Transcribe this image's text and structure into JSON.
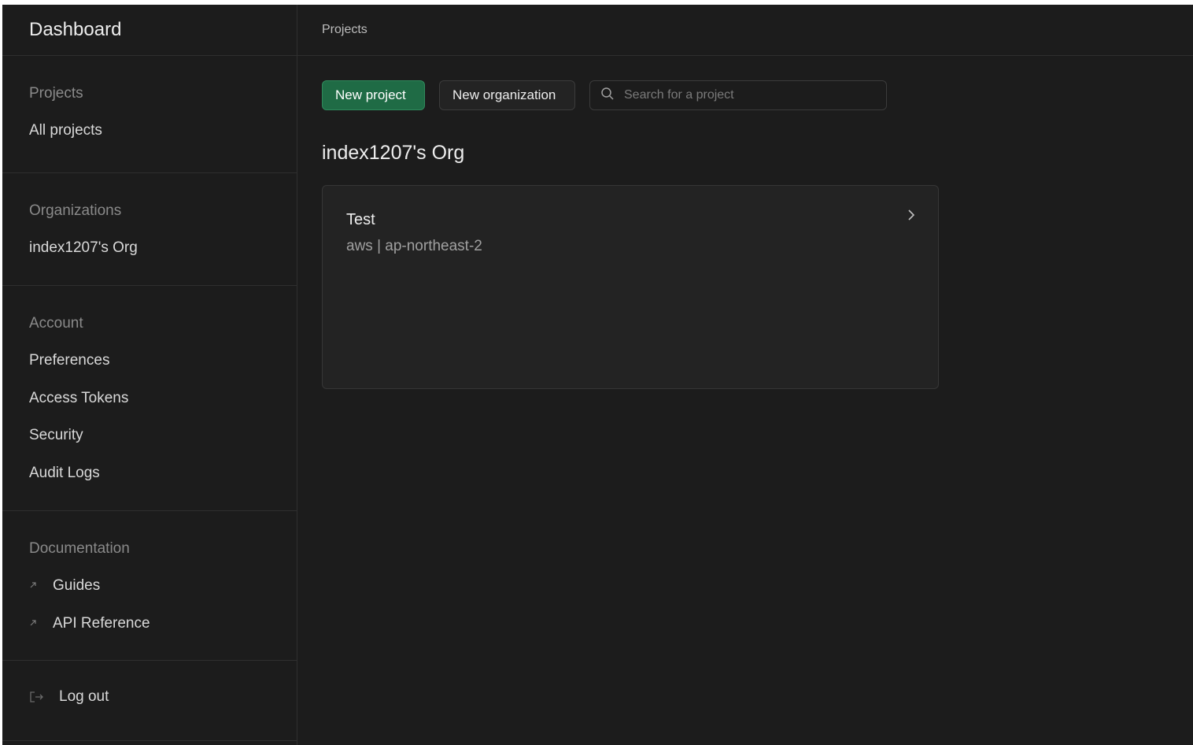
{
  "sidebar": {
    "brand": "Dashboard",
    "projects": {
      "heading": "Projects",
      "items": [
        {
          "label": "All projects"
        }
      ]
    },
    "organizations": {
      "heading": "Organizations",
      "items": [
        {
          "label": "index1207's Org"
        }
      ]
    },
    "account": {
      "heading": "Account",
      "items": [
        {
          "label": "Preferences"
        },
        {
          "label": "Access Tokens"
        },
        {
          "label": "Security"
        },
        {
          "label": "Audit Logs"
        }
      ]
    },
    "documentation": {
      "heading": "Documentation",
      "items": [
        {
          "label": "Guides",
          "icon": "external-link-icon"
        },
        {
          "label": "API Reference",
          "icon": "external-link-icon"
        }
      ]
    },
    "logout": {
      "label": "Log out",
      "icon": "logout-icon"
    }
  },
  "header": {
    "breadcrumb": "Projects"
  },
  "toolbar": {
    "new_project_label": "New project",
    "new_org_label": "New organization",
    "search_placeholder": "Search for a project",
    "search_value": "",
    "search_icon": "search-icon"
  },
  "org": {
    "name": "index1207's Org",
    "projects": [
      {
        "name": "Test",
        "details": "aws | ap-northeast-2",
        "icon": "chevron-right-icon"
      }
    ]
  },
  "colors": {
    "background": "#1c1c1c",
    "card": "#232323",
    "accent": "#1f6b45",
    "border": "#2f2f2f"
  }
}
